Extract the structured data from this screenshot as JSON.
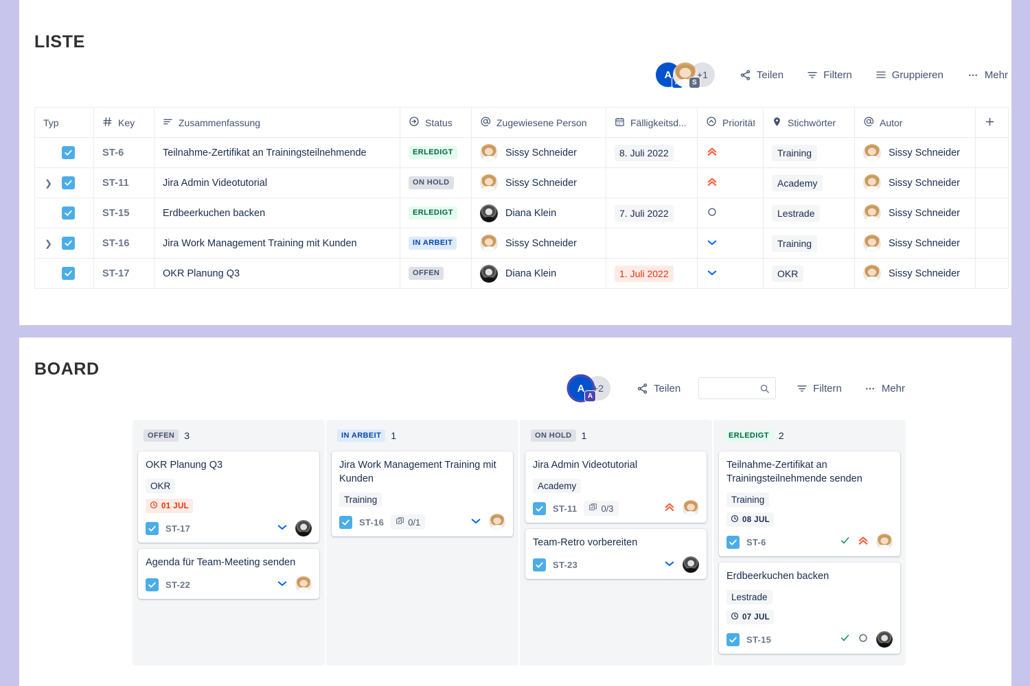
{
  "list_section": {
    "title": "LISTE",
    "toolbar": {
      "avatars": [
        {
          "type": "initial",
          "initial": "A",
          "badge": "A",
          "badge_style": "blue"
        },
        {
          "type": "photo",
          "photo": "sissy",
          "badge": "S",
          "badge_style": "grey"
        }
      ],
      "more_avatars": "+1",
      "share_label": "Teilen",
      "filter_label": "Filtern",
      "group_label": "Gruppieren",
      "more_label": "Mehr"
    },
    "columns": [
      {
        "key": "typ",
        "label": "Typ",
        "icon": ""
      },
      {
        "key": "key",
        "label": "Key",
        "icon": "hash-icon"
      },
      {
        "key": "summary",
        "label": "Zusammenfassung",
        "icon": "text-lines-icon"
      },
      {
        "key": "status",
        "label": "Status",
        "icon": "arrow-circle-icon"
      },
      {
        "key": "assignee",
        "label": "Zugewiesene Person",
        "icon": "at-icon"
      },
      {
        "key": "due",
        "label": "Fälligkeitsd...",
        "icon": "calendar-icon"
      },
      {
        "key": "priority",
        "label": "Priorität",
        "icon": "chevron-circle-icon"
      },
      {
        "key": "labels",
        "label": "Stichwörter",
        "icon": "tag-icon"
      },
      {
        "key": "author",
        "label": "Autor",
        "icon": "at-icon"
      },
      {
        "key": "add",
        "label": "+",
        "icon": "plus-icon"
      }
    ],
    "rows": [
      {
        "expandable": false,
        "key": "ST-6",
        "summary": "Teilnahme-Zertifikat an Trainingsteilnehmende",
        "status": "ERLEDIGT",
        "status_style": "green",
        "assignee": "Sissy Schneider",
        "assignee_photo": "sissy",
        "due": "8. Juli 2022",
        "due_overdue": false,
        "priority": "highest",
        "label": "Training",
        "author": "Sissy Schneider",
        "author_photo": "sissy"
      },
      {
        "expandable": true,
        "key": "ST-11",
        "summary": "Jira Admin Videotutorial",
        "status": "ON HOLD",
        "status_style": "grey",
        "assignee": "Sissy Schneider",
        "assignee_photo": "sissy",
        "due": "",
        "due_overdue": false,
        "priority": "highest",
        "label": "Academy",
        "author": "Sissy Schneider",
        "author_photo": "sissy"
      },
      {
        "expandable": false,
        "key": "ST-15",
        "summary": "Erdbeerkuchen backen",
        "status": "ERLEDIGT",
        "status_style": "green",
        "assignee": "Diana Klein",
        "assignee_photo": "diana",
        "due": "7. Juli 2022",
        "due_overdue": false,
        "priority": "medium",
        "label": "Lestrade",
        "author": "Sissy Schneider",
        "author_photo": "sissy"
      },
      {
        "expandable": true,
        "key": "ST-16",
        "summary": "Jira Work Management Training mit Kunden",
        "status": "IN ARBEIT",
        "status_style": "blue",
        "assignee": "Sissy Schneider",
        "assignee_photo": "sissy",
        "due": "",
        "due_overdue": false,
        "priority": "low",
        "label": "Training",
        "author": "Sissy Schneider",
        "author_photo": "sissy"
      },
      {
        "expandable": false,
        "key": "ST-17",
        "summary": "OKR Planung Q3",
        "status": "OFFEN",
        "status_style": "grey",
        "assignee": "Diana Klein",
        "assignee_photo": "diana",
        "due": "1. Juli 2022",
        "due_overdue": true,
        "priority": "low",
        "label": "OKR",
        "author": "Sissy Schneider",
        "author_photo": "sissy"
      }
    ]
  },
  "board_section": {
    "title": "BOARD",
    "toolbar": {
      "avatars": [
        {
          "type": "initial",
          "initial": "A",
          "badge": "A",
          "badge_style": "purple",
          "ring": true
        }
      ],
      "more_avatars": "+2",
      "share_label": "Teilen",
      "search_value": "",
      "search_placeholder": "",
      "filter_label": "Filtern",
      "more_label": "Mehr"
    },
    "columns": [
      {
        "status": "OFFEN",
        "status_style": "grey",
        "count": "3",
        "cards": [
          {
            "title": "OKR Planung Q3",
            "label": "OKR",
            "due": "01 JUL",
            "due_overdue": true,
            "key": "ST-17",
            "subtasks": "",
            "done_check": false,
            "priority": "low",
            "avatar": "diana"
          },
          {
            "title": "Agenda für Team-Meeting senden",
            "label": "",
            "due": "",
            "due_overdue": false,
            "key": "ST-22",
            "subtasks": "",
            "done_check": false,
            "priority": "low",
            "avatar": "sissy"
          }
        ]
      },
      {
        "status": "IN ARBEIT",
        "status_style": "blue",
        "count": "1",
        "cards": [
          {
            "title": "Jira Work Management Training mit Kunden",
            "label": "Training",
            "due": "",
            "due_overdue": false,
            "key": "ST-16",
            "subtasks": "0/1",
            "done_check": false,
            "priority": "low",
            "avatar": "sissy"
          }
        ]
      },
      {
        "status": "ON HOLD",
        "status_style": "grey",
        "count": "1",
        "cards": [
          {
            "title": "Jira Admin Videotutorial",
            "label": "Academy",
            "due": "",
            "due_overdue": false,
            "key": "ST-11",
            "subtasks": "0/3",
            "done_check": false,
            "priority": "highest",
            "avatar": "sissy"
          },
          {
            "title": "Team-Retro vorbereiten",
            "label": "",
            "due": "",
            "due_overdue": false,
            "key": "ST-23",
            "subtasks": "",
            "done_check": false,
            "priority": "low",
            "avatar": "diana"
          }
        ]
      },
      {
        "status": "ERLEDIGT",
        "status_style": "green",
        "count": "2",
        "cards": [
          {
            "title": "Teilnahme-Zertifikat an Trainingsteilnehmende senden",
            "label": "Training",
            "due": "08 JUL",
            "due_overdue": false,
            "key": "ST-6",
            "subtasks": "",
            "done_check": true,
            "priority": "highest",
            "avatar": "sissy"
          },
          {
            "title": "Erdbeerkuchen backen",
            "label": "Lestrade",
            "due": "07 JUL",
            "due_overdue": false,
            "key": "ST-15",
            "subtasks": "",
            "done_check": true,
            "priority": "medium",
            "avatar": "diana"
          }
        ]
      }
    ]
  },
  "colors": {
    "page_background": "#c8c5ec",
    "panel_background": "#ffffff",
    "accent_blue": "#0052cc",
    "task_icon_blue": "#4bade8",
    "priority_high": "#ff5630",
    "priority_medium": "#6b778c",
    "priority_low": "#0065ff",
    "done_green": "#006644",
    "overdue_red": "#de350b",
    "column_background": "#f4f5f7"
  }
}
